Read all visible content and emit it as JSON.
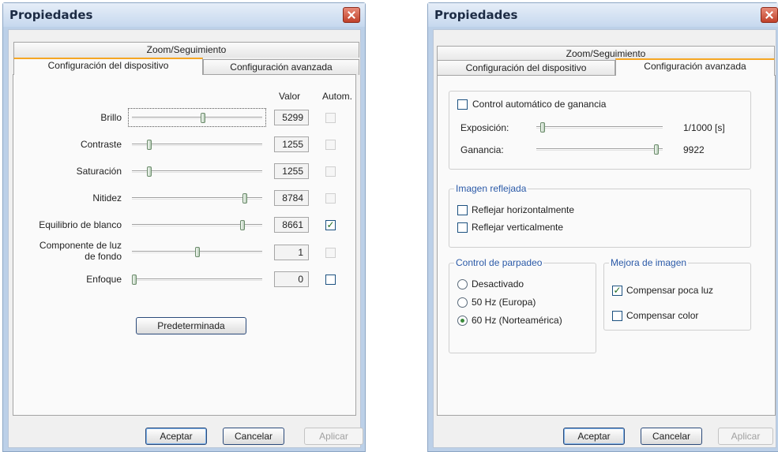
{
  "dialogs": {
    "left": {
      "title": "Propiedades",
      "tabs": {
        "zoom": "Zoom/Seguimiento",
        "device": "Configuración del dispositivo",
        "advanced": "Configuración avanzada"
      },
      "columns": {
        "value": "Valor",
        "auto": "Autom."
      },
      "rows": [
        {
          "label": "Brillo",
          "value": "5299",
          "level": 0.55,
          "auto": false,
          "auto_enabled": false
        },
        {
          "label": "Contraste",
          "value": "1255",
          "level": 0.12,
          "auto": false,
          "auto_enabled": false
        },
        {
          "label": "Saturación",
          "value": "1255",
          "level": 0.12,
          "auto": false,
          "auto_enabled": false
        },
        {
          "label": "Nitidez",
          "value": "8784",
          "level": 0.88,
          "auto": false,
          "auto_enabled": false
        },
        {
          "label": "Equilibrio de blanco",
          "value": "8661",
          "level": 0.86,
          "auto": true,
          "auto_enabled": true
        },
        {
          "label": "Componente de luz de fondo",
          "label_line1": "Componente de luz",
          "label_line2": "de fondo",
          "value": "1",
          "level": 0.5,
          "auto": false,
          "auto_enabled": false
        },
        {
          "label": "Enfoque",
          "value": "0",
          "level": 0.0,
          "auto": false,
          "auto_enabled": true
        }
      ],
      "default_button": "Predeterminada",
      "buttons": {
        "ok": "Aceptar",
        "cancel": "Cancelar",
        "apply": "Aplicar"
      }
    },
    "right": {
      "title": "Propiedades",
      "tabs": {
        "zoom": "Zoom/Seguimiento",
        "device": "Configuración del dispositivo",
        "advanced": "Configuración avanzada"
      },
      "agc": {
        "label": "Control automático de ganancia",
        "checked": false,
        "exposure_label": "Exposición:",
        "exposure_value": "1/1000 [s]",
        "exposure_level": 0.03,
        "gain_label": "Ganancia:",
        "gain_value": "9922",
        "gain_level": 0.97
      },
      "mirror": {
        "legend": "Imagen reflejada",
        "horizontal": "Reflejar horizontalmente",
        "vertical": "Reflejar verticalmente"
      },
      "flicker": {
        "legend": "Control de parpadeo",
        "options": [
          "Desactivado",
          "50 Hz (Europa)",
          "60 Hz (Norteamérica)"
        ],
        "selected": "60 Hz (Norteamérica)"
      },
      "enhance": {
        "legend": "Mejora de imagen",
        "low_light": "Compensar poca luz",
        "low_light_checked": true,
        "color": "Compensar color",
        "color_checked": false
      },
      "buttons": {
        "ok": "Aceptar",
        "cancel": "Cancelar",
        "apply": "Aplicar"
      }
    }
  },
  "colors": {
    "accent_tab": "#f5a623",
    "check_mark": "#1f6b1f",
    "group_legend": "#2b5aa8"
  }
}
